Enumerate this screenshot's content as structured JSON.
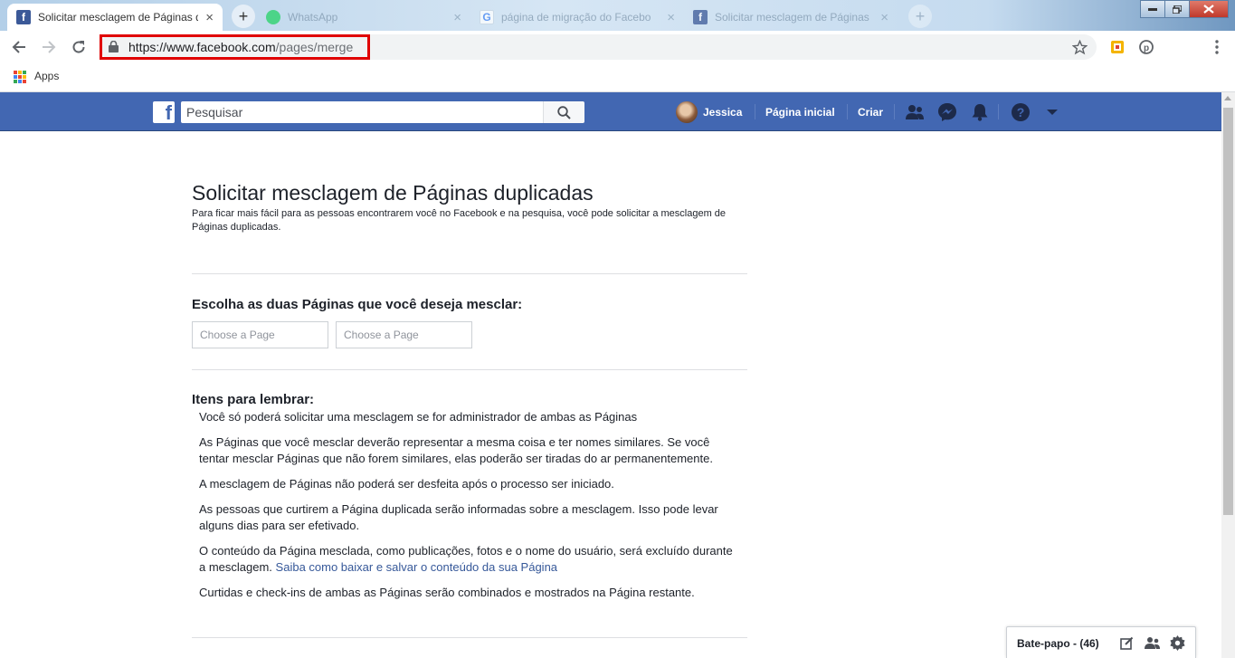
{
  "browser": {
    "tabs": [
      {
        "title": "Solicitar mesclagem de Páginas d",
        "state": "active"
      },
      {
        "title": "WhatsApp",
        "state": "inactive"
      },
      {
        "title": "página de migração do Facebo",
        "state": "inactive"
      },
      {
        "title": "Solicitar mesclagem de Páginas",
        "state": "inactive"
      }
    ],
    "new_tab_glyph": "+",
    "close_glyph": "×",
    "url": {
      "host": "https://www.facebook.com",
      "path": "/pages/merge"
    },
    "bookmarks": {
      "apps_label": "Apps"
    }
  },
  "facebook": {
    "search_placeholder": "Pesquisar",
    "user_name": "Jessica",
    "nav_home": "Página inicial",
    "nav_create": "Criar",
    "brand_color": "#4267b2"
  },
  "page": {
    "title": "Solicitar mesclagem de Páginas duplicadas",
    "intro": "Para ficar mais fácil para as pessoas encontrarem você no Facebook e na pesquisa, você pode solicitar a mesclagem de Páginas duplicadas.",
    "choose_heading": "Escolha as duas Páginas que você deseja mesclar:",
    "chooser_placeholder_1": "Choose a Page",
    "chooser_placeholder_2": "Choose a Page",
    "remember_heading": "Itens para lembrar:",
    "reminders": [
      "Você só poderá solicitar uma mesclagem se for administrador de ambas as Páginas",
      "As Páginas que você mesclar deverão representar a mesma coisa e ter nomes similares. Se você tentar mesclar Páginas que não forem similares, elas poderão ser tiradas do ar permanentemente.",
      "A mesclagem de Páginas não poderá ser desfeita após o processo ser iniciado.",
      "As pessoas que curtirem a Página duplicada serão informadas sobre a mesclagem. Isso pode levar alguns dias para ser efetivado."
    ],
    "reminder_content_text": "O conteúdo da Página mesclada, como publicações, fotos e o nome do usuário, será excluído durante a mesclagem.",
    "reminder_content_link": "Saiba como baixar e salvar o conteúdo da sua Página",
    "reminder_last": "Curtidas e check-ins de ambas as Páginas serão combinados e mostrados na Página restante."
  },
  "chat": {
    "label": "Bate-papo - (46)"
  },
  "icons": [
    "facebook-favicon",
    "whatsapp-favicon",
    "google-favicon",
    "back-icon",
    "forward-icon",
    "reload-icon",
    "lock-icon",
    "star-icon",
    "pinterest-icon",
    "menu-dots-icon",
    "search-icon",
    "friends-icon",
    "messenger-icon",
    "bell-icon",
    "help-icon",
    "caret-down-icon",
    "compose-icon",
    "group-icon",
    "gear-icon"
  ]
}
